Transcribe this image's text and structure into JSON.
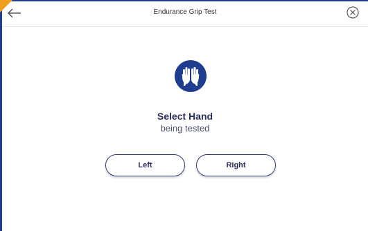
{
  "header": {
    "title": "Endurance Grip Test",
    "back_icon": "arrow-left-icon",
    "close_icon": "circle-x-icon"
  },
  "main": {
    "icon": "raised-hands-icon",
    "heading": "Select Hand",
    "subheading": "being tested",
    "buttons": {
      "left_label": "Left",
      "right_label": "Right"
    }
  },
  "colors": {
    "accent": "#1e3d8f",
    "corner": "#f0a020",
    "text_primary": "#2b2f5f"
  }
}
